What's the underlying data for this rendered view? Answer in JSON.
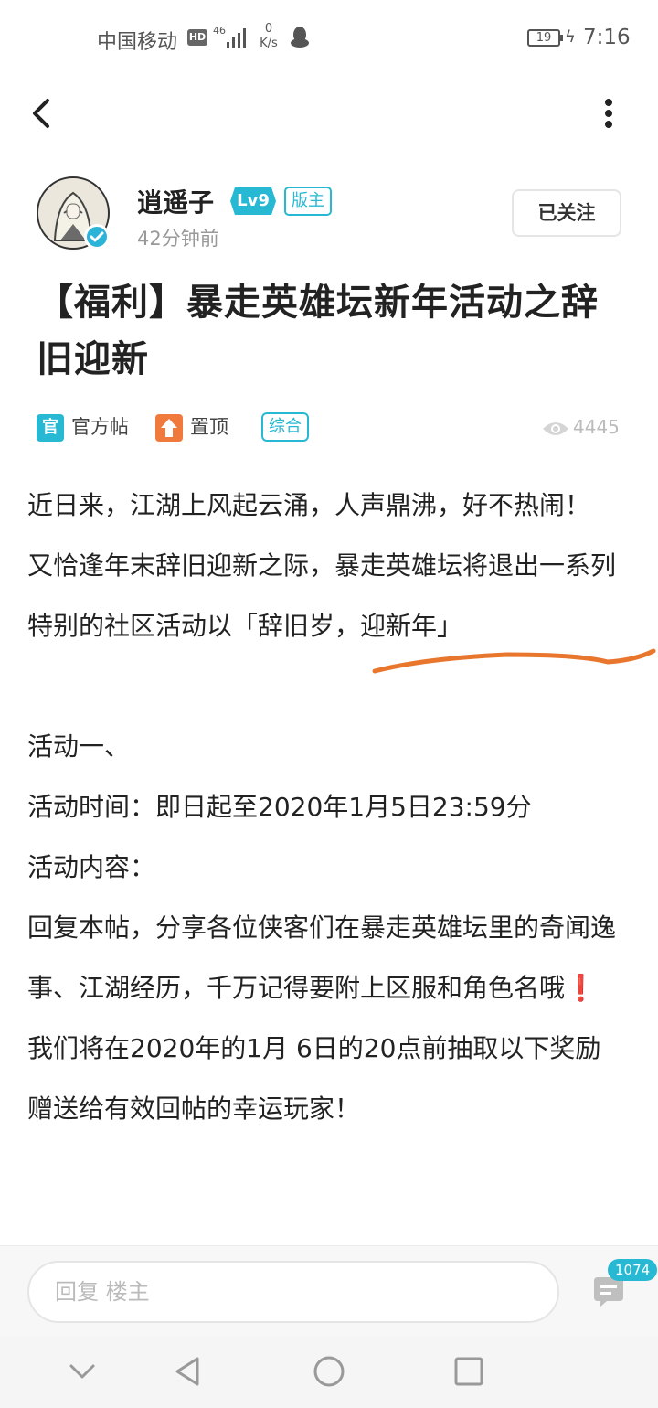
{
  "status_bar": {
    "carrier": "中国移动",
    "hd": "HD",
    "network": "46",
    "speed_value": "0",
    "speed_unit": "K/s",
    "battery": "19",
    "time": "7:16"
  },
  "author": {
    "name": "逍遥子",
    "level": "Lv9",
    "role": "版主",
    "posted": "42分钟前",
    "follow_label": "已关注"
  },
  "post": {
    "title": "【福利】暴走英雄坛新年活动之辞旧迎新",
    "meta": {
      "official_icon": "官",
      "official_label": "官方帖",
      "pinned_label": "置顶",
      "category": "综合",
      "views": "4445"
    },
    "paragraphs": [
      "近日来，江湖上风起云涌，人声鼎沸，好不热闹！",
      "又恰逢年末辞旧迎新之际，暴走英雄坛将退出一系列特别的社区活动以「辞旧岁，迎新年」",
      "活动一、",
      "活动时间：即日起至2020年1月5日23:59分",
      "活动内容：",
      "回复本帖，分享各位侠客们在暴走英雄坛里的奇闻逸事、江湖经历，千万记得要附上区服和角色名哦❗",
      "我们将在2020年的1月 6日的20点前抽取以下奖励赠送给有效回帖的幸运玩家！"
    ]
  },
  "reply_bar": {
    "placeholder": "回复  楼主",
    "comment_count": "1074"
  },
  "colors": {
    "accent": "#27b9d3",
    "pinned": "#f07a3c",
    "scribble": "#e8762c"
  }
}
